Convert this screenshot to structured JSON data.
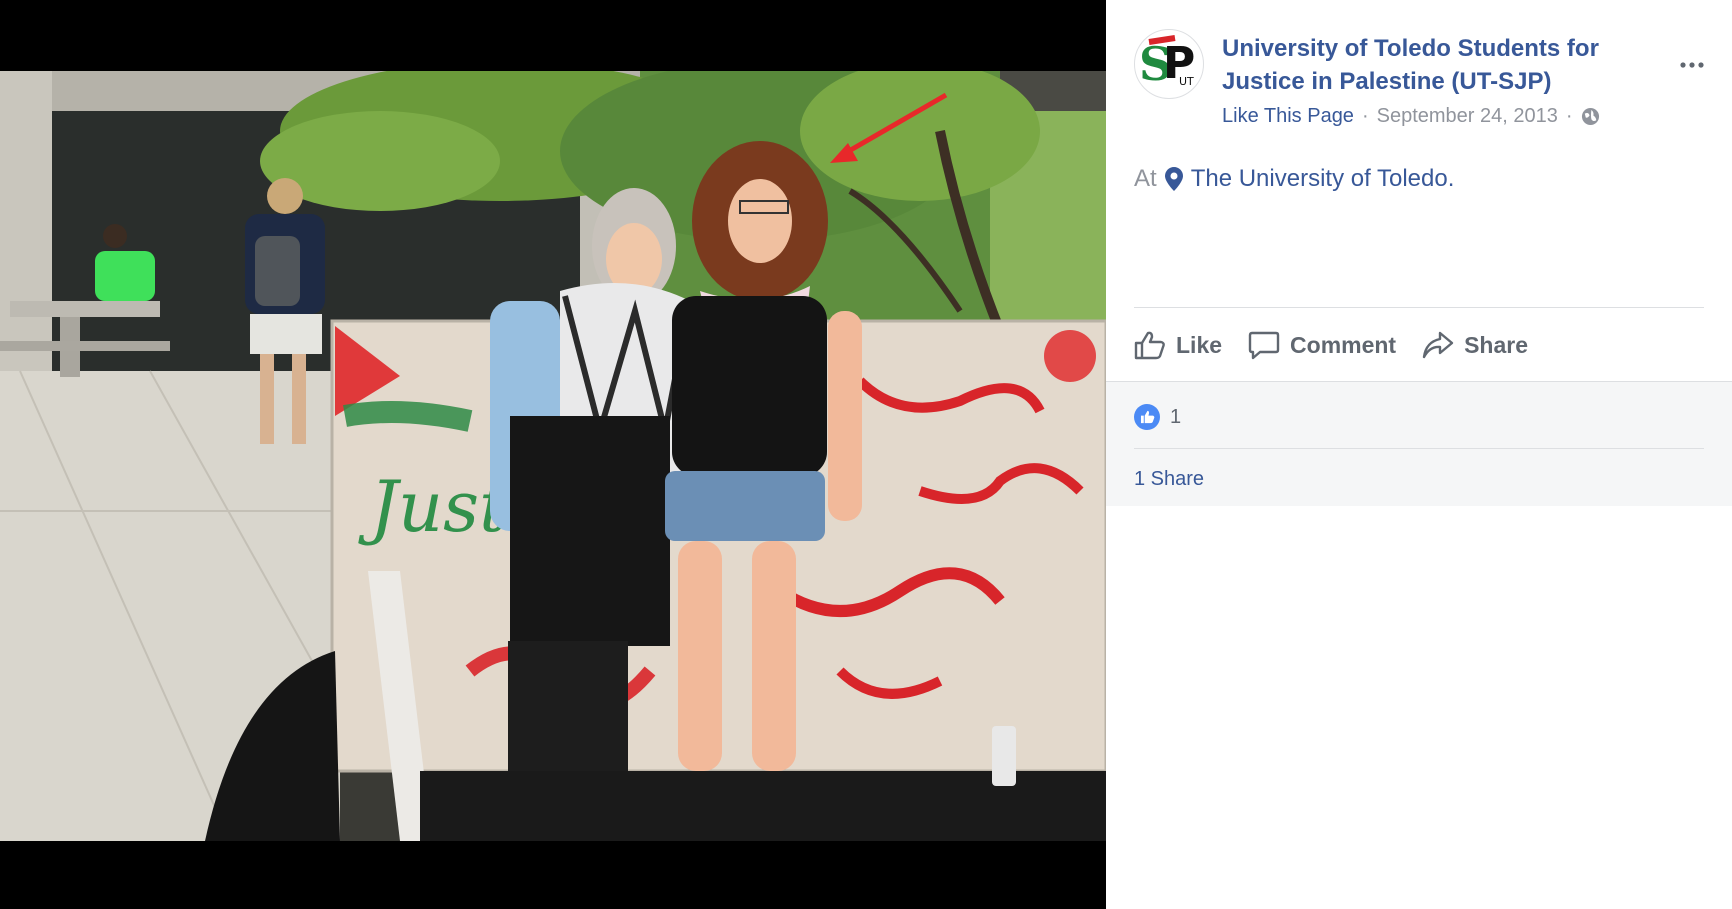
{
  "post": {
    "page_name": "University of Toledo Students for Justice in Palestine (UT-SJP)",
    "like_page_label": "Like This Page",
    "separator": "·",
    "date": "September 24, 2013",
    "privacy_icon": "globe-icon",
    "more_icon": "more-horizontal-icon",
    "location_prefix": "At",
    "location_icon": "map-pin-icon",
    "location_name": "The University of Toledo."
  },
  "avatar": {
    "logo_letters": "SP",
    "logo_sub": "UT"
  },
  "photo": {
    "wall_graffiti": "Justice for"
  },
  "actions": {
    "like_label": "Like",
    "comment_label": "Comment",
    "share_label": "Share"
  },
  "engagement": {
    "reaction_icon": "thumbs-up-icon",
    "reaction_count": "1",
    "shares_label": "1 Share"
  },
  "colors": {
    "link_blue": "#385898",
    "meta_gray": "#90949c",
    "action_gray": "#606770",
    "like_blue": "#4b8af5",
    "panel_gray": "#f5f6f7",
    "divider": "#dddfe2"
  }
}
